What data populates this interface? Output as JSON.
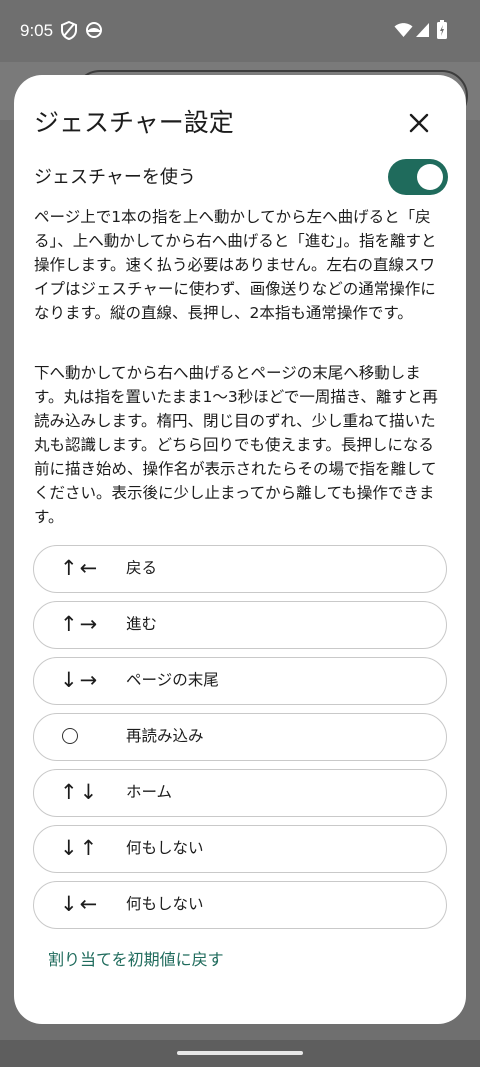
{
  "status_bar": {
    "time": "9:05",
    "icons": [
      "shield-icon",
      "browser-icon",
      "wifi-icon",
      "signal-icon",
      "battery-charging-icon"
    ]
  },
  "sheet": {
    "title": "ジェスチャー設定",
    "close_icon": "close-icon",
    "toggle": {
      "label": "ジェスチャーを使う",
      "on": true
    },
    "description": [
      "ページ上で1本の指を上へ動かしてから左へ曲げると「戻る」、上へ動かしてから右へ曲げると「進む」。指を離すと操作します。速く払う必要はありません。左右の直線スワイプはジェスチャーに使わず、画像送りなどの通常操作になります。縦の直線、長押し、2本指も通常操作です。",
      "下へ動かしてから右へ曲げるとページの末尾へ移動します。丸は指を置いたまま1〜3秒ほどで一周描き、離すと再読み込みします。楕円、閉じ目のずれ、少し重ねて描いた丸も認識します。どちら回りでも使えます。長押しになる前に描き始め、操作名が表示されたらその場で指を離してください。表示後に少し止まってから離しても操作できます。"
    ],
    "gestures": [
      {
        "symbol": "↑←",
        "action": "戻る"
      },
      {
        "symbol": "↑→",
        "action": "進む"
      },
      {
        "symbol": "↓→",
        "action": "ページの末尾"
      },
      {
        "symbol": "○",
        "action": "再読み込み"
      },
      {
        "symbol": "↑↓",
        "action": "ホーム"
      },
      {
        "symbol": "↓↑",
        "action": "何もしない"
      },
      {
        "symbol": "↓←",
        "action": "何もしない"
      }
    ],
    "reset_label": "割り当てを初期値に戻す"
  },
  "colors": {
    "accent": "#1f6b5c",
    "scrim": "#6f6f6f",
    "sheet_bg": "#ffffff",
    "text": "#1c1c1c",
    "outline": "#c9c9c9"
  }
}
